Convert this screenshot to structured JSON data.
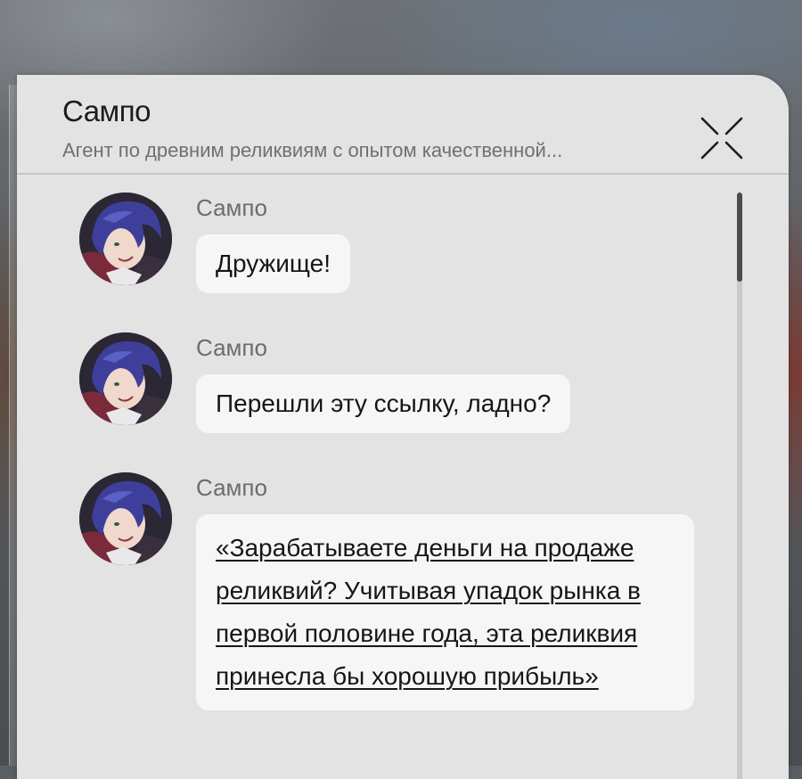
{
  "dialog": {
    "title": "Сампо",
    "subtitle": "Агент по древним реликвиям с опытом качественной..."
  },
  "icons": {
    "close": "close-x-icon",
    "avatar": "sampo-avatar"
  },
  "colors": {
    "panel": "#e3e3e3",
    "bubble": "#f6f6f6",
    "sender_text": "#6c6c6c",
    "scroll_thumb": "#4c4c4c"
  },
  "messages": [
    {
      "sender": "Сампо",
      "text": "Дружище!",
      "is_link": false
    },
    {
      "sender": "Сампо",
      "text": "Перешли эту ссылку, ладно?",
      "is_link": false
    },
    {
      "sender": "Сампо",
      "text": "«Зарабатываете деньги на продаже реликвий? Учитывая упадок рынка в первой половине года, эта реликвия принесла бы хорошую прибыль»",
      "is_link": true
    }
  ]
}
